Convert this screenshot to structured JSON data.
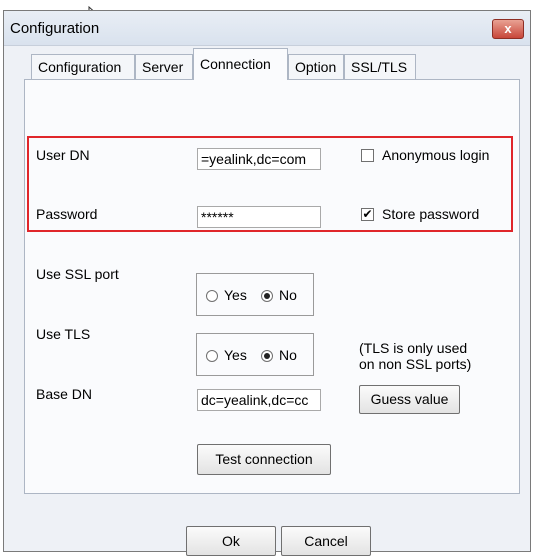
{
  "window": {
    "title": "Configuration",
    "close_symbol": "x"
  },
  "tabs": [
    {
      "label": "Configuration"
    },
    {
      "label": "Server"
    },
    {
      "label": "Connection",
      "active": true
    },
    {
      "label": "Option"
    },
    {
      "label": "SSL/TLS"
    }
  ],
  "form": {
    "user_dn_label": "User DN",
    "user_dn_value": "=yealink,dc=com",
    "anonymous_login_label": "Anonymous login",
    "anonymous_login_checked": false,
    "password_label": "Password",
    "password_value": "******",
    "store_password_label": "Store password",
    "store_password_checked": true,
    "checkmark": "✔",
    "use_ssl_port_label": "Use SSL port",
    "use_tls_label": "Use TLS",
    "yes_label": "Yes",
    "no_label": "No",
    "ssl_selected": "No",
    "tls_selected": "No",
    "tls_note_line1": "(TLS is only used",
    "tls_note_line2": "on non SSL ports)",
    "base_dn_label": "Base DN",
    "base_dn_value": "dc=yealink,dc=cc",
    "guess_value_button": "Guess value",
    "test_connection_button": "Test connection"
  },
  "footer": {
    "ok_button": "Ok",
    "cancel_button": "Cancel"
  },
  "colors": {
    "highlight_border": "#e0262b",
    "close_button": "#c8463a"
  }
}
